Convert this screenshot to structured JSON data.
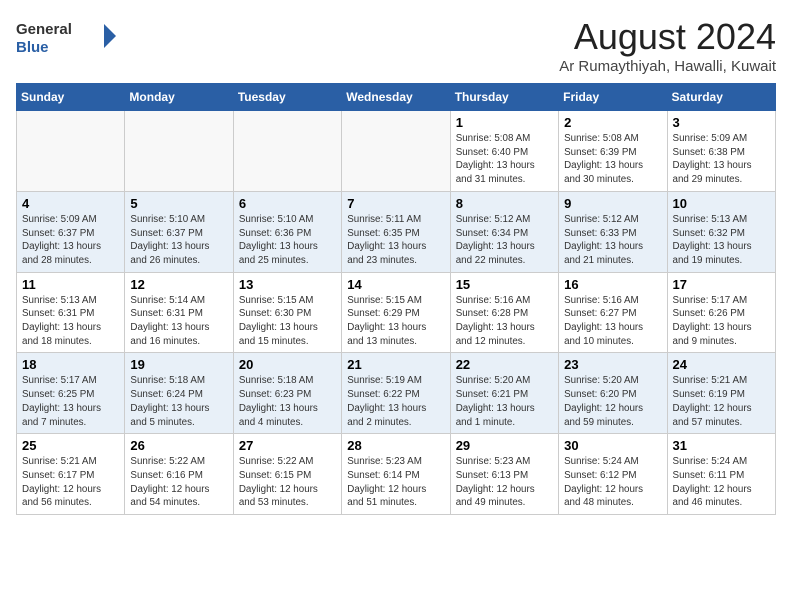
{
  "header": {
    "logo_general": "General",
    "logo_blue": "Blue",
    "month_title": "August 2024",
    "subtitle": "Ar Rumaythiyah, Hawalli, Kuwait"
  },
  "days_of_week": [
    "Sunday",
    "Monday",
    "Tuesday",
    "Wednesday",
    "Thursday",
    "Friday",
    "Saturday"
  ],
  "weeks": [
    [
      {
        "day": "",
        "content": ""
      },
      {
        "day": "",
        "content": ""
      },
      {
        "day": "",
        "content": ""
      },
      {
        "day": "",
        "content": ""
      },
      {
        "day": "1",
        "content": "Sunrise: 5:08 AM\nSunset: 6:40 PM\nDaylight: 13 hours\nand 31 minutes."
      },
      {
        "day": "2",
        "content": "Sunrise: 5:08 AM\nSunset: 6:39 PM\nDaylight: 13 hours\nand 30 minutes."
      },
      {
        "day": "3",
        "content": "Sunrise: 5:09 AM\nSunset: 6:38 PM\nDaylight: 13 hours\nand 29 minutes."
      }
    ],
    [
      {
        "day": "4",
        "content": "Sunrise: 5:09 AM\nSunset: 6:37 PM\nDaylight: 13 hours\nand 28 minutes."
      },
      {
        "day": "5",
        "content": "Sunrise: 5:10 AM\nSunset: 6:37 PM\nDaylight: 13 hours\nand 26 minutes."
      },
      {
        "day": "6",
        "content": "Sunrise: 5:10 AM\nSunset: 6:36 PM\nDaylight: 13 hours\nand 25 minutes."
      },
      {
        "day": "7",
        "content": "Sunrise: 5:11 AM\nSunset: 6:35 PM\nDaylight: 13 hours\nand 23 minutes."
      },
      {
        "day": "8",
        "content": "Sunrise: 5:12 AM\nSunset: 6:34 PM\nDaylight: 13 hours\nand 22 minutes."
      },
      {
        "day": "9",
        "content": "Sunrise: 5:12 AM\nSunset: 6:33 PM\nDaylight: 13 hours\nand 21 minutes."
      },
      {
        "day": "10",
        "content": "Sunrise: 5:13 AM\nSunset: 6:32 PM\nDaylight: 13 hours\nand 19 minutes."
      }
    ],
    [
      {
        "day": "11",
        "content": "Sunrise: 5:13 AM\nSunset: 6:31 PM\nDaylight: 13 hours\nand 18 minutes."
      },
      {
        "day": "12",
        "content": "Sunrise: 5:14 AM\nSunset: 6:31 PM\nDaylight: 13 hours\nand 16 minutes."
      },
      {
        "day": "13",
        "content": "Sunrise: 5:15 AM\nSunset: 6:30 PM\nDaylight: 13 hours\nand 15 minutes."
      },
      {
        "day": "14",
        "content": "Sunrise: 5:15 AM\nSunset: 6:29 PM\nDaylight: 13 hours\nand 13 minutes."
      },
      {
        "day": "15",
        "content": "Sunrise: 5:16 AM\nSunset: 6:28 PM\nDaylight: 13 hours\nand 12 minutes."
      },
      {
        "day": "16",
        "content": "Sunrise: 5:16 AM\nSunset: 6:27 PM\nDaylight: 13 hours\nand 10 minutes."
      },
      {
        "day": "17",
        "content": "Sunrise: 5:17 AM\nSunset: 6:26 PM\nDaylight: 13 hours\nand 9 minutes."
      }
    ],
    [
      {
        "day": "18",
        "content": "Sunrise: 5:17 AM\nSunset: 6:25 PM\nDaylight: 13 hours\nand 7 minutes."
      },
      {
        "day": "19",
        "content": "Sunrise: 5:18 AM\nSunset: 6:24 PM\nDaylight: 13 hours\nand 5 minutes."
      },
      {
        "day": "20",
        "content": "Sunrise: 5:18 AM\nSunset: 6:23 PM\nDaylight: 13 hours\nand 4 minutes."
      },
      {
        "day": "21",
        "content": "Sunrise: 5:19 AM\nSunset: 6:22 PM\nDaylight: 13 hours\nand 2 minutes."
      },
      {
        "day": "22",
        "content": "Sunrise: 5:20 AM\nSunset: 6:21 PM\nDaylight: 13 hours\nand 1 minute."
      },
      {
        "day": "23",
        "content": "Sunrise: 5:20 AM\nSunset: 6:20 PM\nDaylight: 12 hours\nand 59 minutes."
      },
      {
        "day": "24",
        "content": "Sunrise: 5:21 AM\nSunset: 6:19 PM\nDaylight: 12 hours\nand 57 minutes."
      }
    ],
    [
      {
        "day": "25",
        "content": "Sunrise: 5:21 AM\nSunset: 6:17 PM\nDaylight: 12 hours\nand 56 minutes."
      },
      {
        "day": "26",
        "content": "Sunrise: 5:22 AM\nSunset: 6:16 PM\nDaylight: 12 hours\nand 54 minutes."
      },
      {
        "day": "27",
        "content": "Sunrise: 5:22 AM\nSunset: 6:15 PM\nDaylight: 12 hours\nand 53 minutes."
      },
      {
        "day": "28",
        "content": "Sunrise: 5:23 AM\nSunset: 6:14 PM\nDaylight: 12 hours\nand 51 minutes."
      },
      {
        "day": "29",
        "content": "Sunrise: 5:23 AM\nSunset: 6:13 PM\nDaylight: 12 hours\nand 49 minutes."
      },
      {
        "day": "30",
        "content": "Sunrise: 5:24 AM\nSunset: 6:12 PM\nDaylight: 12 hours\nand 48 minutes."
      },
      {
        "day": "31",
        "content": "Sunrise: 5:24 AM\nSunset: 6:11 PM\nDaylight: 12 hours\nand 46 minutes."
      }
    ]
  ]
}
